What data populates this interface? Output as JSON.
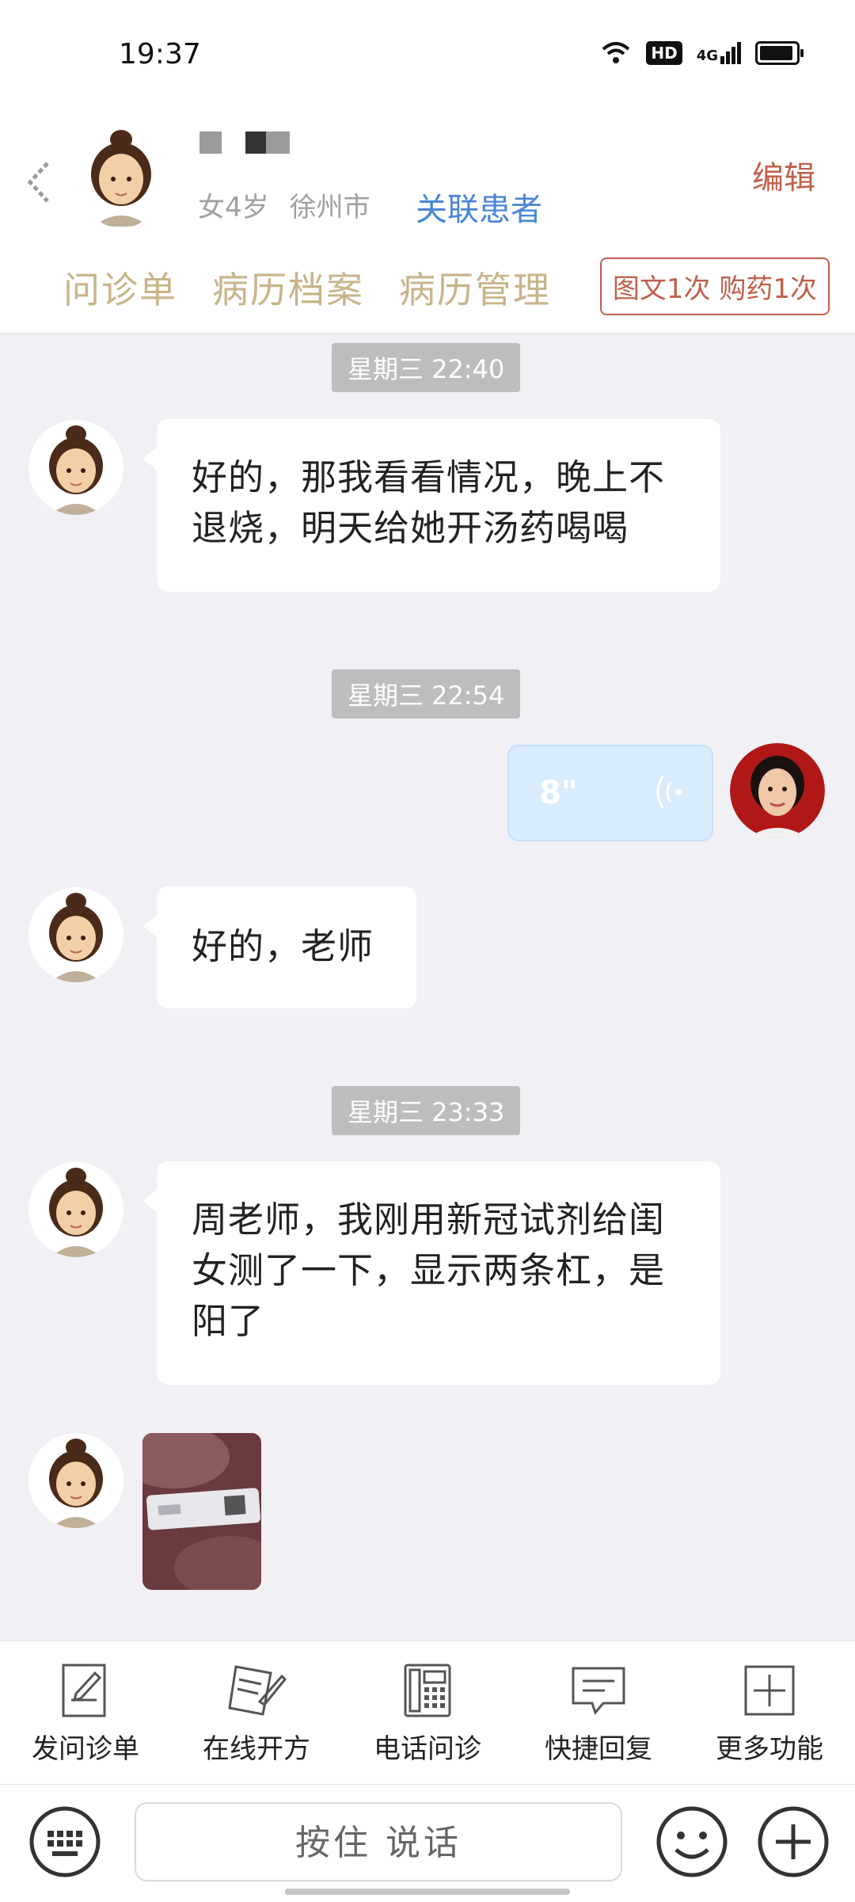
{
  "status_bar": {
    "time": "19:37",
    "hd": "HD",
    "network": "4G"
  },
  "header": {
    "patient_info": {
      "gender": "女",
      "age": "4岁",
      "city": "徐州市"
    },
    "link_patient": "关联患者",
    "edit": "编辑",
    "tabs": [
      "问诊单",
      "病历档案",
      "病历管理"
    ],
    "quota_badge": "图文1次 购药1次"
  },
  "messages": [
    {
      "type": "time",
      "text": "星期三 22:40"
    },
    {
      "type": "text",
      "side": "left",
      "text": "好的，那我看看情况，晚上不退烧，明天给她开汤药喝喝"
    },
    {
      "type": "time",
      "text": "星期三 22:54"
    },
    {
      "type": "voice",
      "side": "right",
      "duration": "8\""
    },
    {
      "type": "text",
      "side": "left",
      "text": "好的，老师"
    },
    {
      "type": "time",
      "text": "星期三 23:33"
    },
    {
      "type": "text",
      "side": "left",
      "text": "周老师，我刚用新冠试剂给闺女测了一下，显示两条杠，是阳了"
    },
    {
      "type": "image",
      "side": "left",
      "description_icon": "photo-thumbnail"
    }
  ],
  "toolbar": {
    "items": [
      {
        "label": "发问诊单",
        "icon": "form-edit-icon"
      },
      {
        "label": "在线开方",
        "icon": "prescription-pen-icon"
      },
      {
        "label": "电话问诊",
        "icon": "phone-icon"
      },
      {
        "label": "快捷回复",
        "icon": "chat-bubble-icon"
      },
      {
        "label": "更多功能",
        "icon": "plus-square-icon"
      }
    ]
  },
  "input": {
    "hold_to_talk": "按住 说话"
  },
  "colors": {
    "accent_gold": "#c8b48a",
    "accent_red": "#c0604a",
    "link_blue": "#4a86d6",
    "chat_bg": "#f0f0f5"
  }
}
